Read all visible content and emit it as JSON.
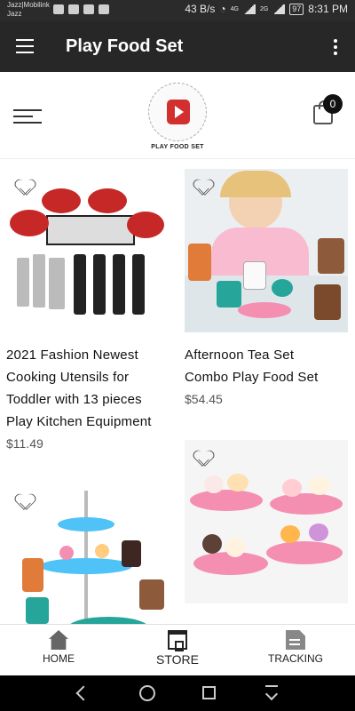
{
  "status_bar": {
    "carrier_line1": "Jazz|Mobilink",
    "carrier_line2": "Jazz",
    "network_speed": "43 B/s",
    "signal1_label": "4G",
    "signal2_label": "2G",
    "battery": "97",
    "time": "8:31 PM"
  },
  "app_bar": {
    "title": "Play Food Set"
  },
  "brand": {
    "logo_text": "PLAY FOOD SET",
    "cart_count": "0"
  },
  "products": [
    {
      "title_lines": [
        "2021 Fashion Newest",
        "Cooking Utensils for",
        "Toddler with 13 pieces",
        "Play Kitchen Equipment"
      ],
      "price": "$11.49"
    },
    {
      "title_lines": [
        "Afternoon Tea Set",
        "Combo Play Food Set"
      ],
      "price": "$54.45"
    },
    {
      "title_lines": [],
      "price": ""
    },
    {
      "title_lines": [],
      "price": ""
    }
  ],
  "bottom_nav": {
    "items": [
      {
        "label": "HOME",
        "icon": "home-icon"
      },
      {
        "label": "STORE",
        "icon": "store-icon"
      },
      {
        "label": "TRACKING",
        "icon": "tracking-icon"
      }
    ]
  },
  "system_nav": {
    "icons": [
      "back-icon",
      "home-circle-icon",
      "recents-icon",
      "notification-down-icon"
    ]
  },
  "colors": {
    "app_bar": "#272727",
    "accent_red": "#c62828",
    "pink": "#f48fb1",
    "teal": "#26a69a"
  }
}
